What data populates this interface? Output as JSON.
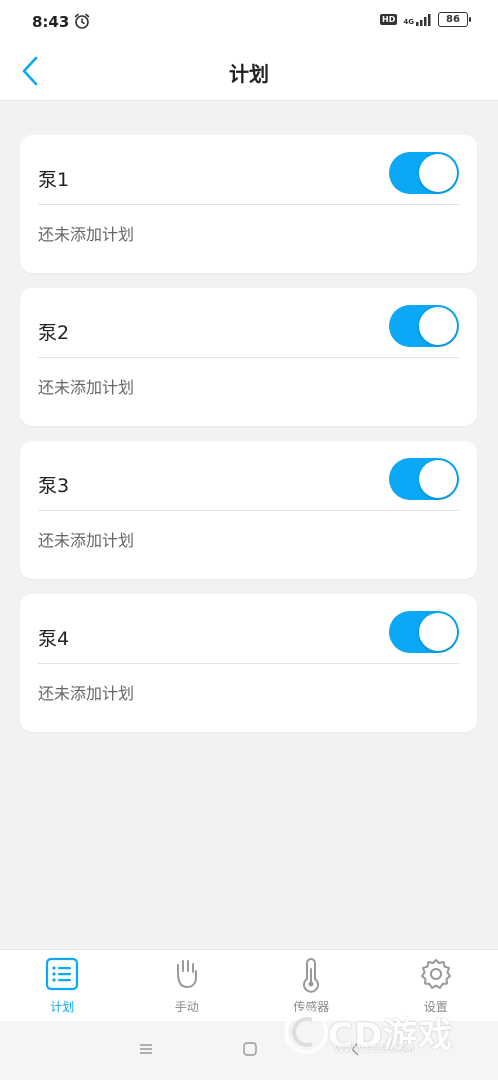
{
  "status_bar": {
    "time": "8:43",
    "hd_badge": "HD",
    "network": "4G",
    "battery": "86"
  },
  "header": {
    "title": "计划"
  },
  "pumps": [
    {
      "name": "泵1",
      "status": "还未添加计划",
      "enabled": true
    },
    {
      "name": "泵2",
      "status": "还未添加计划",
      "enabled": true
    },
    {
      "name": "泵3",
      "status": "还未添加计划",
      "enabled": true
    },
    {
      "name": "泵4",
      "status": "还未添加计划",
      "enabled": true
    }
  ],
  "tabs": [
    {
      "label": "计划",
      "icon": "schedule-list-icon",
      "active": true
    },
    {
      "label": "手动",
      "icon": "hand-icon",
      "active": false
    },
    {
      "label": "传感器",
      "icon": "thermometer-icon",
      "active": false
    },
    {
      "label": "设置",
      "icon": "gear-icon",
      "active": false
    }
  ],
  "watermark": {
    "text": "CD游戏",
    "url": "WWW.CDB.COM"
  },
  "colors": {
    "accent": "#0aa8f5",
    "background": "#f2f2f2",
    "card": "#ffffff"
  }
}
